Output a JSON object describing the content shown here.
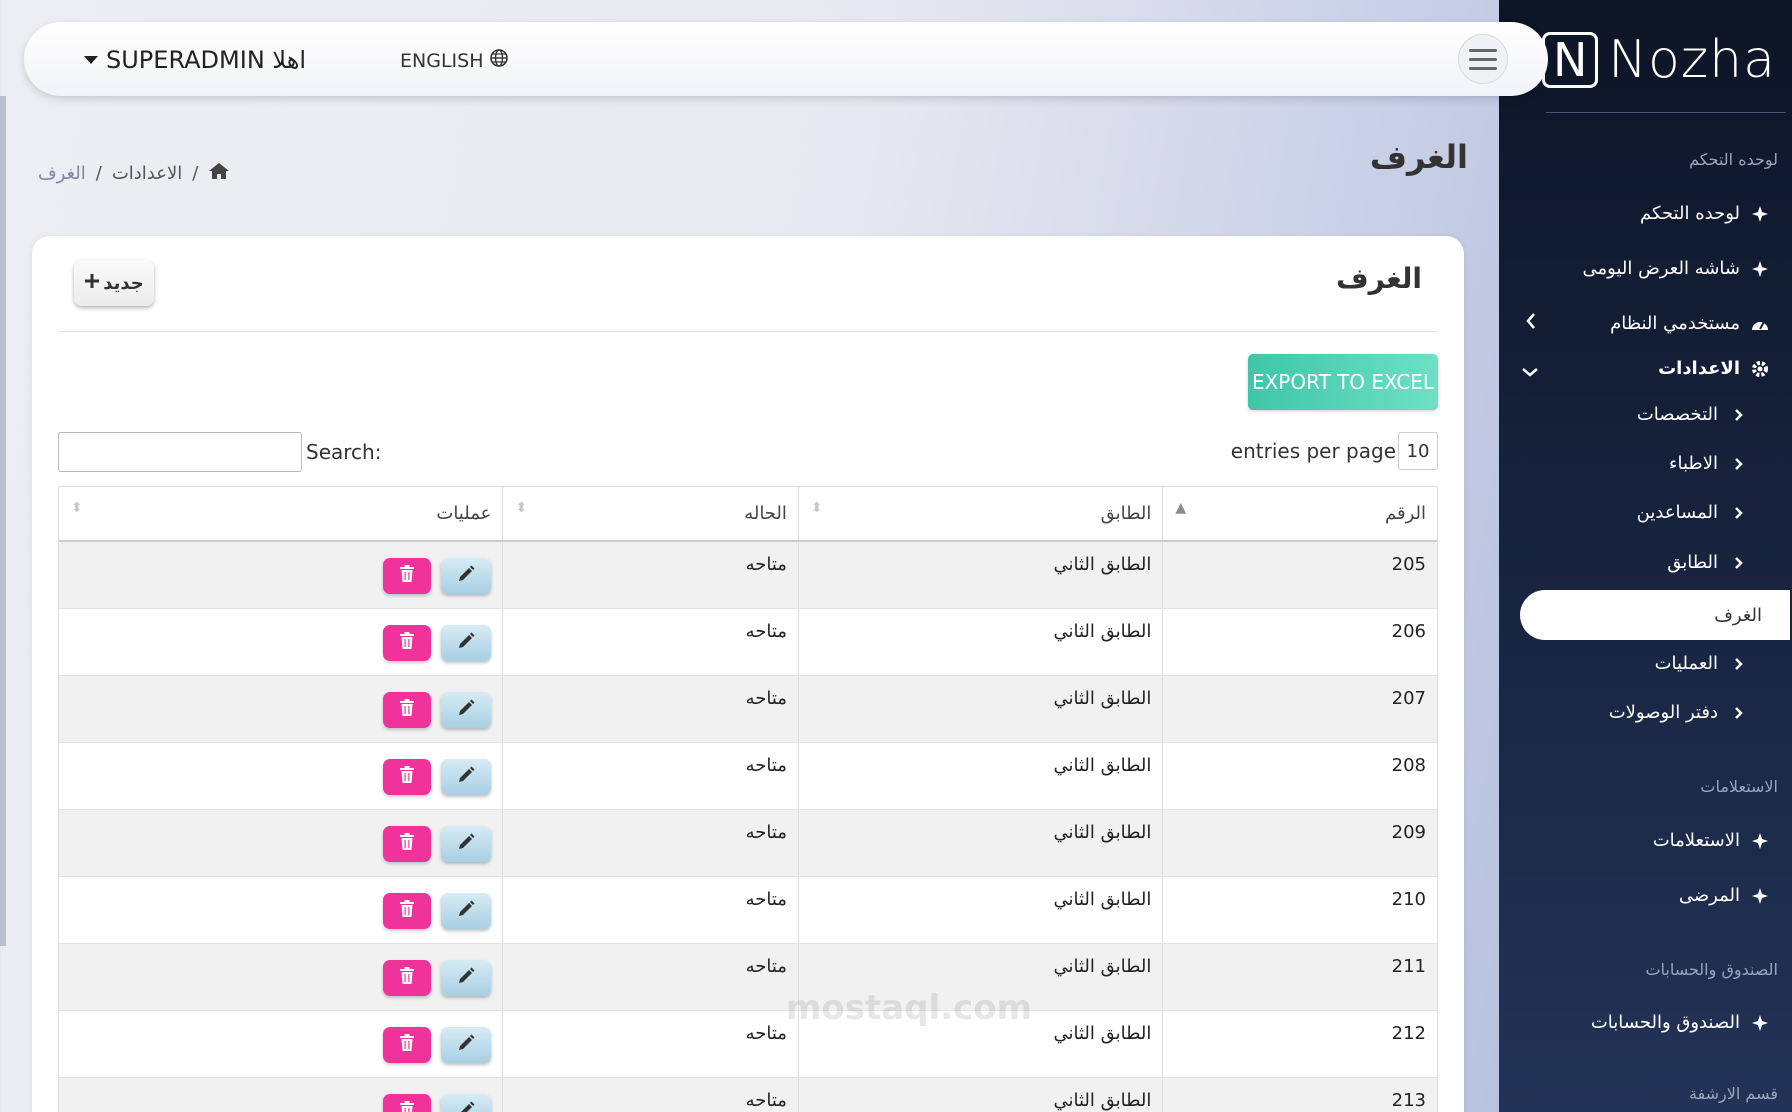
{
  "brand": {
    "letter": "N",
    "name": "Nozha"
  },
  "topbar": {
    "user_label": "SUPERADMIN اهلا",
    "language_label": "ENGLISH"
  },
  "page": {
    "title": "الغرف"
  },
  "breadcrumb": {
    "item1": "الاعدادات",
    "separator": "/",
    "current": "الغرف"
  },
  "sidebar": {
    "section_dashboard": "لوحده التحكم",
    "item_dashboard": "لوحده التحكم",
    "item_daily_display": "شاشه العرض اليومى",
    "item_system_users": "مستخدمي النظام",
    "item_settings": "الاعدادات",
    "sub_specialties": "التخصصات",
    "sub_doctors": "الاطباء",
    "sub_assistants": "المساعدين",
    "sub_floor": "الطابق",
    "sub_rooms": "الغرف",
    "sub_operations": "العمليات",
    "sub_receipts": "دفتر الوصولات",
    "section_inquiries": "الاستعلامات",
    "item_inquiries": "الاستعلامات",
    "item_patients": "المرضى",
    "section_treasury": "الصندوق والحسابات",
    "item_treasury": "الصندوق والحسابات",
    "section_guidance": "قسم الارشفة"
  },
  "card": {
    "title": "الغرف",
    "new_button": "جديد",
    "export_button": "EXPORT TO EXCEL",
    "entries_value": "10",
    "entries_label": "entries per page",
    "search_label": "Search:"
  },
  "table": {
    "headers": {
      "number": "الرقم",
      "floor": "الطابق",
      "status": "الحاله",
      "actions": "عمليات"
    },
    "rows": [
      {
        "number": "205",
        "floor": "الطابق الثاني",
        "status": "متاحه"
      },
      {
        "number": "206",
        "floor": "الطابق الثاني",
        "status": "متاحه"
      },
      {
        "number": "207",
        "floor": "الطابق الثاني",
        "status": "متاحه"
      },
      {
        "number": "208",
        "floor": "الطابق الثاني",
        "status": "متاحه"
      },
      {
        "number": "209",
        "floor": "الطابق الثاني",
        "status": "متاحه"
      },
      {
        "number": "210",
        "floor": "الطابق الثاني",
        "status": "متاحه"
      },
      {
        "number": "211",
        "floor": "الطابق الثاني",
        "status": "متاحه"
      },
      {
        "number": "212",
        "floor": "الطابق الثاني",
        "status": "متاحه"
      },
      {
        "number": "213",
        "floor": "الطابق الثاني",
        "status": "متاحه"
      }
    ]
  },
  "watermark": "mostaql.com",
  "colors": {
    "accent_pink": "#f0339a",
    "export_green": "#3ec6a8",
    "sidebar_bg": "#0d1526"
  },
  "icons": [
    "home-icon",
    "globe-icon",
    "plus-icon",
    "edit-icon",
    "trash-icon",
    "gear-icon",
    "dashboard-icon",
    "chevron-left-icon",
    "chevron-down-icon",
    "menu-icon"
  ]
}
